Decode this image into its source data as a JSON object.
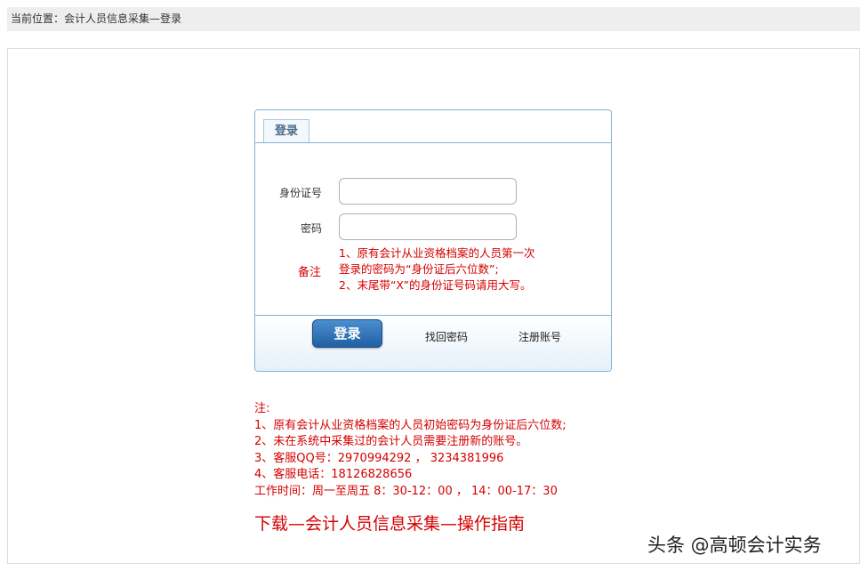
{
  "breadcrumb": "当前位置：会计人员信息采集—登录",
  "login": {
    "tab_label": "登录",
    "id_label": "身份证号",
    "id_value": "",
    "password_label": "密码",
    "password_value": "",
    "remark_label": "备注",
    "remark_lines": [
      "1、原有会计从业资格档案的人员第一次",
      "登录的密码为“身份证后六位数”;",
      "2、末尾带“X”的身份证号码请用大写。"
    ],
    "login_button": "登录",
    "find_password": "找回密码",
    "register": "注册账号"
  },
  "notes": {
    "title": "注:",
    "lines": [
      "1、原有会计从业资格档案的人员初始密码为身份证后六位数;",
      "2、未在系统中采集过的会计人员需要注册新的账号。",
      "3、客服QQ号：2970994292 ， 3234381996",
      "4、客服电话：18126828656",
      "工作时间：周一至周五 8：30-12：00 ， 14：00-17：30"
    ]
  },
  "guide_link": "下载—会计人员信息采集—操作指南",
  "watermark": "头条 @高顿会计实务",
  "colors": {
    "accent_blue": "#7fb3d6",
    "notice_red": "#d40000",
    "button_blue": "#2f74bd"
  }
}
